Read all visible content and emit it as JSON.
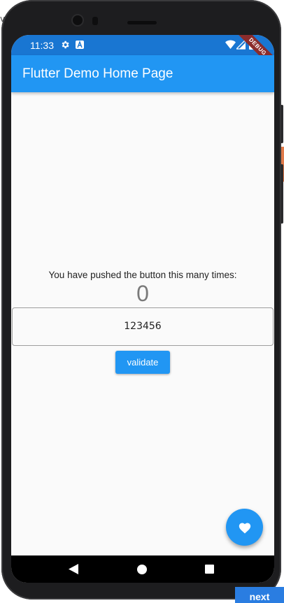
{
  "status_bar": {
    "time": "11:33",
    "icons": [
      "settings-icon",
      "a-icon",
      "wifi-icon",
      "signal-icon",
      "battery-icon"
    ]
  },
  "debug_banner": "DEBUG",
  "app_bar": {
    "title": "Flutter Demo Home Page"
  },
  "main": {
    "counter_label": "You have pushed the button this many times:",
    "counter_value": "0",
    "code_field": {
      "value": "123456"
    },
    "validate_label": "validate"
  },
  "fab": {
    "icon": "heart-icon"
  },
  "navigation": {
    "icons": [
      "back-icon",
      "home-icon",
      "recents-icon"
    ]
  },
  "desktop": {
    "corner_char": "v",
    "next_label": "next"
  },
  "colors": {
    "primary": "#2196f3",
    "primary_dark": "#1976d2",
    "background": "#fafafa"
  }
}
